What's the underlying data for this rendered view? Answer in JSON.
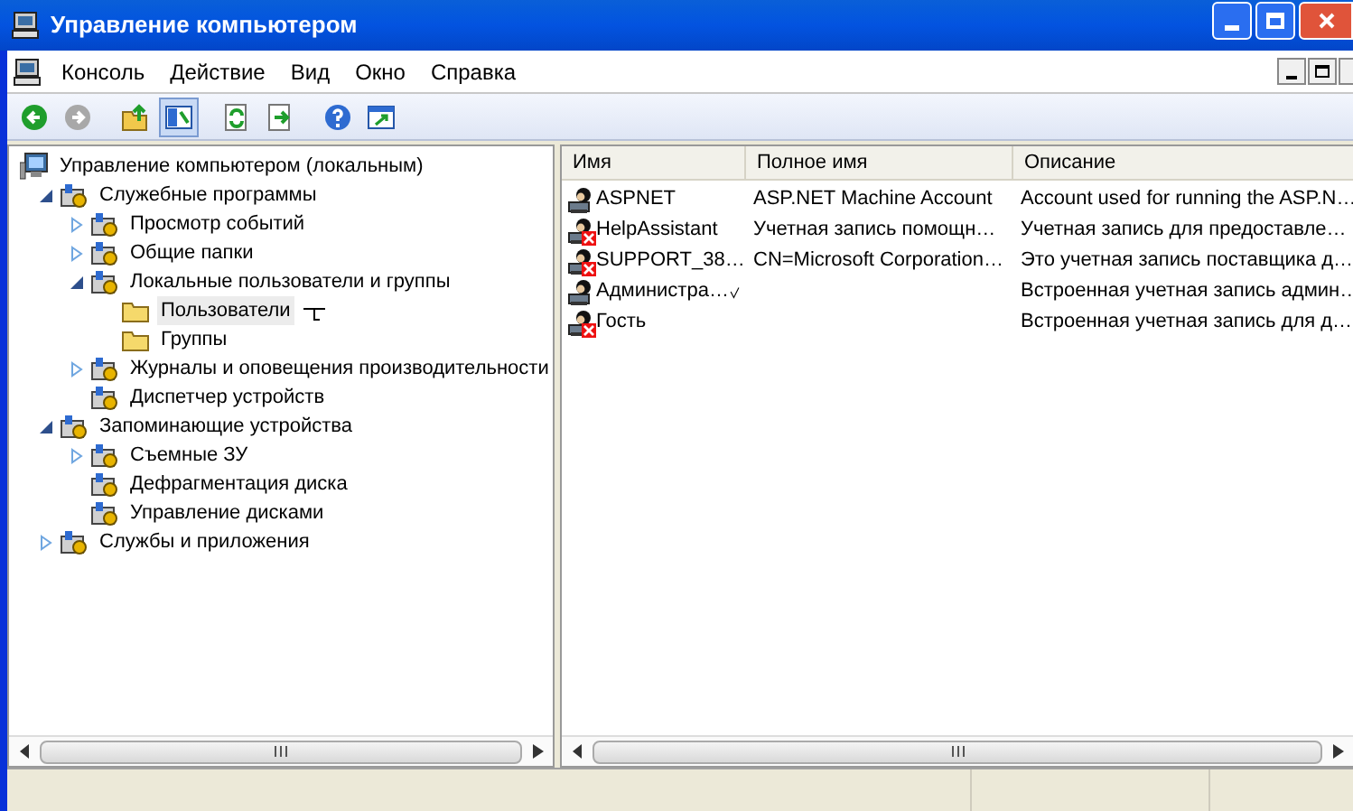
{
  "window": {
    "title": "Управление компьютером"
  },
  "menu": [
    "Консоль",
    "Действие",
    "Вид",
    "Окно",
    "Справка"
  ],
  "tree": [
    {
      "label": "Управление компьютером (локальным)",
      "selected": false,
      "children": [
        {
          "label": "Служебные программы",
          "expanded": true,
          "selected": false,
          "children": [
            {
              "label": "Просмотр событий",
              "expanded": false,
              "selected": false
            },
            {
              "label": "Общие папки",
              "expanded": false,
              "selected": false
            },
            {
              "label": "Локальные пользователи и группы",
              "expanded": true,
              "selected": false,
              "children": [
                {
                  "label": "Пользователи",
                  "selected": true
                },
                {
                  "label": "Группы",
                  "selected": false
                }
              ]
            },
            {
              "label": "Журналы и оповещения производительности",
              "expanded": false,
              "selected": false
            },
            {
              "label": "Диспетчер устройств",
              "selected": false
            }
          ]
        },
        {
          "label": "Запоминающие устройства",
          "expanded": true,
          "selected": false,
          "children": [
            {
              "label": "Съемные ЗУ",
              "expanded": false,
              "selected": false
            },
            {
              "label": "Дефрагментация диска",
              "selected": false
            },
            {
              "label": "Управление дисками",
              "selected": false
            }
          ]
        },
        {
          "label": "Службы и приложения",
          "expanded": false,
          "selected": false
        }
      ]
    }
  ],
  "table": {
    "columns": [
      "Имя",
      "Полное имя",
      "Описание"
    ],
    "rows": [
      {
        "cells": [
          "ASPNET",
          "ASP.NET Machine Account",
          "Account used for running the ASP.N…"
        ],
        "disabled": false
      },
      {
        "cells": [
          "HelpAssistant",
          "Учетная запись помощн…",
          "Учетная запись для предоставле…"
        ],
        "disabled": true
      },
      {
        "cells": [
          "SUPPORT_38…",
          "CN=Microsoft Corporation…",
          "Это учетная запись поставщика д…"
        ],
        "disabled": true
      },
      {
        "cells": [
          "Администра…",
          "",
          "Встроенная учетная запись админ…"
        ],
        "disabled": false
      },
      {
        "cells": [
          "Гость",
          "",
          "Встроенная учетная запись для д…"
        ],
        "disabled": true
      }
    ]
  }
}
